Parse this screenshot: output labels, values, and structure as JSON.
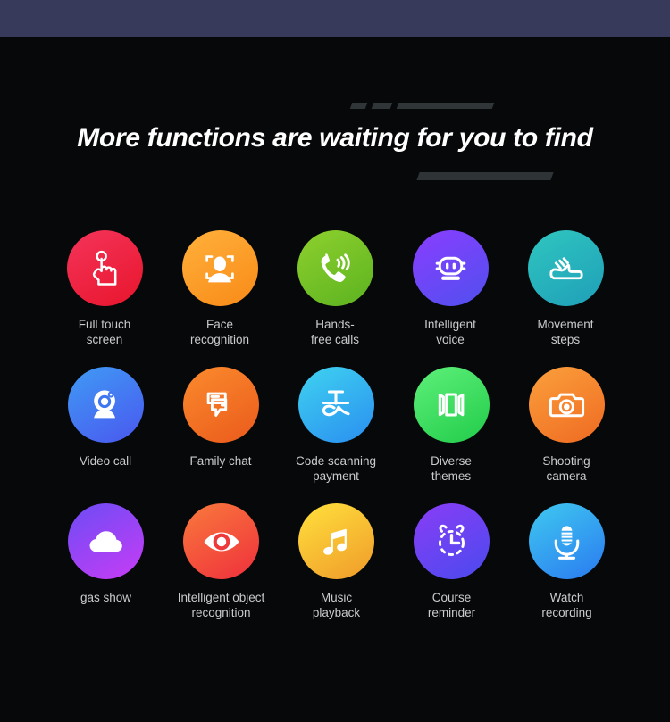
{
  "page": {
    "background_color": "#07080a",
    "top_bar_color": "#383a5c",
    "label_color": "#c9cbcd",
    "title_color": "#ffffff",
    "decoration_color": "#303538"
  },
  "header": {
    "title": "More functions are waiting for you to find"
  },
  "features": {
    "rows": [
      [
        {
          "label": "Full touch\nscreen",
          "label_line1": "Full touch",
          "label_line2": "screen",
          "icon": "touch-hand-icon",
          "color_from": "#f4345a",
          "color_to": "#e8152c"
        },
        {
          "label": "Face\nrecognition",
          "label_line1": "Face",
          "label_line2": "recognition",
          "icon": "face-recognition-icon",
          "color_from": "#ffb13b",
          "color_to": "#f98a18"
        },
        {
          "label": "Hands-\nfree calls",
          "label_line1": "Hands-",
          "label_line2": "free calls",
          "icon": "phone-call-icon",
          "color_from": "#8ed02e",
          "color_to": "#5cb320"
        },
        {
          "label": "Intelligent\nvoice",
          "label_line1": "Intelligent",
          "label_line2": "voice",
          "icon": "robot-voice-icon",
          "color_from": "#8a3dff",
          "color_to": "#5050ee"
        },
        {
          "label": "Movement\nsteps",
          "label_line1": "Movement",
          "label_line2": "steps",
          "icon": "sneaker-icon",
          "color_from": "#2fc6c0",
          "color_to": "#1f9fb8"
        }
      ],
      [
        {
          "label": "Video call",
          "label_line1": "Video call",
          "label_line2": "",
          "icon": "webcam-icon",
          "color_from": "#3f9bf5",
          "color_to": "#4a57ef"
        },
        {
          "label": "Family chat",
          "label_line1": "Family chat",
          "label_line2": "",
          "icon": "chat-bubble-icon",
          "color_from": "#fb8b2d",
          "color_to": "#ea5a1c"
        },
        {
          "label": "Code scanning\npayment",
          "label_line1": "Code scanning",
          "label_line2": "payment",
          "icon": "alipay-scan-icon",
          "color_from": "#3fd3f0",
          "color_to": "#2a8ef0"
        },
        {
          "label": "Diverse\nthemes",
          "label_line1": "Diverse",
          "label_line2": "themes",
          "icon": "carousel-themes-icon",
          "color_from": "#5ef07a",
          "color_to": "#22cc4a"
        },
        {
          "label": "Shooting\ncamera",
          "label_line1": "Shooting",
          "label_line2": "camera",
          "icon": "camera-icon",
          "color_from": "#fba03c",
          "color_to": "#ef6a22"
        }
      ],
      [
        {
          "label": "gas show",
          "label_line1": "gas show",
          "label_line2": "",
          "icon": "cloud-icon",
          "color_from": "#6c4cf5",
          "color_to": "#c83cf5"
        },
        {
          "label": "Intelligent object\nrecognition",
          "label_line1": "Intelligent object",
          "label_line2": "recognition",
          "icon": "eye-icon",
          "color_from": "#f97a3c",
          "color_to": "#ef2f3c"
        },
        {
          "label": "Music\nplayback",
          "label_line1": "Music",
          "label_line2": "playback",
          "icon": "music-note-icon",
          "color_from": "#ffe13c",
          "color_to": "#f09a2a"
        },
        {
          "label": "Course\nreminder",
          "label_line1": "Course",
          "label_line2": "reminder",
          "icon": "alarm-clock-icon",
          "color_from": "#8a3df5",
          "color_to": "#4a4aef"
        },
        {
          "label": "Watch\nrecording",
          "label_line1": "Watch",
          "label_line2": "recording",
          "icon": "microphone-icon",
          "color_from": "#3fc9f0",
          "color_to": "#2a7af0"
        }
      ]
    ]
  }
}
